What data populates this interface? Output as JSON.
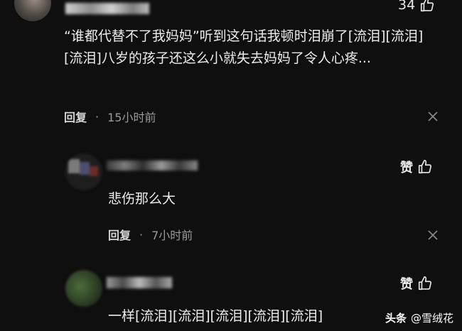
{
  "comments": [
    {
      "like_count": "34",
      "text": "“谁都代替不了我妈妈”听到这句话我顿时泪崩了[流泪][流泪][流泪]八岁的孩子还这么小就失去妈妈了令人心疼...",
      "reply_label": "回复",
      "time": "15小时前"
    },
    {
      "like_label": "赞",
      "text": "悲伤那么大",
      "reply_label": "回复",
      "time": "7小时前"
    },
    {
      "like_label": "赞",
      "text": "一样[流泪][流泪][流泪][流泪][流泪]"
    }
  ],
  "watermark": {
    "brand": "头条",
    "handle": "@雪绒花"
  },
  "icons": [
    "thumbs-up-icon",
    "close-icon"
  ]
}
